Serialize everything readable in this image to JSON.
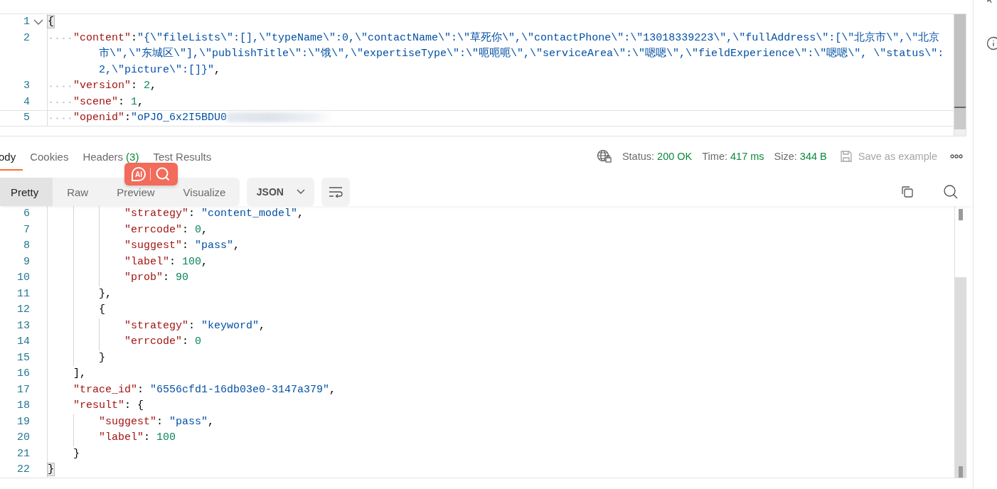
{
  "request_editor": {
    "lines": [
      {
        "number": "1",
        "foldable": true,
        "current": false,
        "tokens": [
          {
            "kind": "match",
            "text": "{"
          }
        ]
      },
      {
        "children": [
          {
            "number": "2",
            "foldable": false,
            "current": false,
            "tokens": [
              {
                "kind": "key",
                "text": "\"content\""
              },
              {
                "kind": "punct",
                "text": ":"
              },
              {
                "kind": "str",
                "text": "\"{\\\"fileLists\\\":[],\\\"typeName\\\":0,\\\"contactName\\\":\\\"草死你\\\",\\\"contactPhone\\\":\\\"13018339223\\\",\\\"fullAddress\\\":[\\\"北京市\\\",\\\"北京市\\\",\\\"东城区\\\"],\\\"publishTitle\\\":\\\"饿\\\",\\\"expertiseType\\\":\\\"呃呃呃\\\",\\\"serviceArea\\\":\\\"嗯嗯\\\",\\\"fieldExperience\\\":\\\"嗯嗯\\\", \\\"status\\\":2,\\\"picture\\\":[]}\""
              },
              {
                "kind": "punct",
                "text": ","
              }
            ]
          },
          {
            "number": "3",
            "foldable": false,
            "current": false,
            "tokens": [
              {
                "kind": "key",
                "text": "\"version\""
              },
              {
                "kind": "punct",
                "text": ": "
              },
              {
                "kind": "num",
                "text": "2"
              },
              {
                "kind": "punct",
                "text": ","
              }
            ]
          },
          {
            "number": "4",
            "foldable": false,
            "current": false,
            "tokens": [
              {
                "kind": "key",
                "text": "\"scene\""
              },
              {
                "kind": "punct",
                "text": ": "
              },
              {
                "kind": "num",
                "text": "1"
              },
              {
                "kind": "punct",
                "text": ","
              }
            ]
          },
          {
            "number": "5",
            "foldable": false,
            "current": true,
            "tokens": [
              {
                "kind": "key",
                "text": "\"openid\""
              },
              {
                "kind": "punct",
                "text": ":"
              },
              {
                "kind": "str",
                "text": "\"oPJO_6x2I5BDU0"
              },
              {
                "kind": "redacted"
              }
            ]
          }
        ]
      }
    ]
  },
  "response_tabs": [
    {
      "label": "ody",
      "selected": true
    },
    {
      "label": "Cookies",
      "selected": false
    },
    {
      "label": "Headers",
      "count": "(3)",
      "selected": false
    },
    {
      "label": "Test Results",
      "selected": false
    }
  ],
  "overlay_badge": {
    "text": "AI"
  },
  "response_meta": [
    {
      "label": "Status:",
      "value": "200 OK"
    },
    {
      "label": "Time:",
      "value": "417 ms"
    },
    {
      "label": "Size:",
      "value": "344 B"
    }
  ],
  "save_button": "Save as example",
  "view_modes": [
    {
      "label": "Pretty",
      "selected": true
    },
    {
      "label": "Raw",
      "selected": false
    },
    {
      "label": "Preview",
      "selected": false
    },
    {
      "label": "Visualize",
      "selected": false
    }
  ],
  "format_select": "JSON",
  "response_body": {
    "lines": [
      {
        "children": [
          {
            "children": [
              {
                "children": [
                  {
                    "number": "6",
                    "tokens": [
                      {
                        "kind": "key",
                        "text": "\"strategy\""
                      },
                      {
                        "kind": "punct",
                        "text": ": "
                      },
                      {
                        "kind": "str",
                        "text": "\"content_model\""
                      },
                      {
                        "kind": "punct",
                        "text": ","
                      }
                    ]
                  },
                  {
                    "number": "7",
                    "tokens": [
                      {
                        "kind": "key",
                        "text": "\"errcode\""
                      },
                      {
                        "kind": "punct",
                        "text": ": "
                      },
                      {
                        "kind": "num",
                        "text": "0"
                      },
                      {
                        "kind": "punct",
                        "text": ","
                      }
                    ]
                  },
                  {
                    "number": "8",
                    "tokens": [
                      {
                        "kind": "key",
                        "text": "\"suggest\""
                      },
                      {
                        "kind": "punct",
                        "text": ": "
                      },
                      {
                        "kind": "str",
                        "text": "\"pass\""
                      },
                      {
                        "kind": "punct",
                        "text": ","
                      }
                    ]
                  },
                  {
                    "number": "9",
                    "tokens": [
                      {
                        "kind": "key",
                        "text": "\"label\""
                      },
                      {
                        "kind": "punct",
                        "text": ": "
                      },
                      {
                        "kind": "num",
                        "text": "100"
                      },
                      {
                        "kind": "punct",
                        "text": ","
                      }
                    ]
                  },
                  {
                    "number": "10",
                    "tokens": [
                      {
                        "kind": "key",
                        "text": "\"prob\""
                      },
                      {
                        "kind": "punct",
                        "text": ": "
                      },
                      {
                        "kind": "num",
                        "text": "90"
                      }
                    ]
                  }
                ]
              },
              {
                "number": "11",
                "tokens": [
                  {
                    "kind": "punct",
                    "text": "},"
                  }
                ]
              },
              {
                "number": "12",
                "tokens": [
                  {
                    "kind": "punct",
                    "text": "{"
                  }
                ]
              },
              {
                "children": [
                  {
                    "number": "13",
                    "tokens": [
                      {
                        "kind": "key",
                        "text": "\"strategy\""
                      },
                      {
                        "kind": "punct",
                        "text": ": "
                      },
                      {
                        "kind": "str",
                        "text": "\"keyword\""
                      },
                      {
                        "kind": "punct",
                        "text": ","
                      }
                    ]
                  },
                  {
                    "number": "14",
                    "tokens": [
                      {
                        "kind": "key",
                        "text": "\"errcode\""
                      },
                      {
                        "kind": "punct",
                        "text": ": "
                      },
                      {
                        "kind": "num",
                        "text": "0"
                      }
                    ]
                  }
                ]
              },
              {
                "number": "15",
                "tokens": [
                  {
                    "kind": "punct",
                    "text": "}"
                  }
                ]
              }
            ]
          },
          {
            "number": "16",
            "tokens": [
              {
                "kind": "punct",
                "text": "],"
              }
            ]
          },
          {
            "number": "17",
            "tokens": [
              {
                "kind": "key",
                "text": "\"trace_id\""
              },
              {
                "kind": "punct",
                "text": ": "
              },
              {
                "kind": "str",
                "text": "\"6556cfd1-16db03e0-3147a379\""
              },
              {
                "kind": "punct",
                "text": ","
              }
            ]
          },
          {
            "number": "18",
            "tokens": [
              {
                "kind": "key",
                "text": "\"result\""
              },
              {
                "kind": "punct",
                "text": ": {"
              }
            ]
          },
          {
            "children": [
              {
                "number": "19",
                "tokens": [
                  {
                    "kind": "key",
                    "text": "\"suggest\""
                  },
                  {
                    "kind": "punct",
                    "text": ": "
                  },
                  {
                    "kind": "str",
                    "text": "\"pass\""
                  },
                  {
                    "kind": "punct",
                    "text": ","
                  }
                ]
              },
              {
                "number": "20",
                "tokens": [
                  {
                    "kind": "key",
                    "text": "\"label\""
                  },
                  {
                    "kind": "punct",
                    "text": ": "
                  },
                  {
                    "kind": "num",
                    "text": "100"
                  }
                ]
              }
            ]
          },
          {
            "number": "21",
            "tokens": [
              {
                "kind": "punct",
                "text": "}"
              }
            ]
          }
        ]
      },
      {
        "number": "22",
        "tokens": [
          {
            "kind": "match",
            "text": "}"
          }
        ]
      }
    ]
  }
}
